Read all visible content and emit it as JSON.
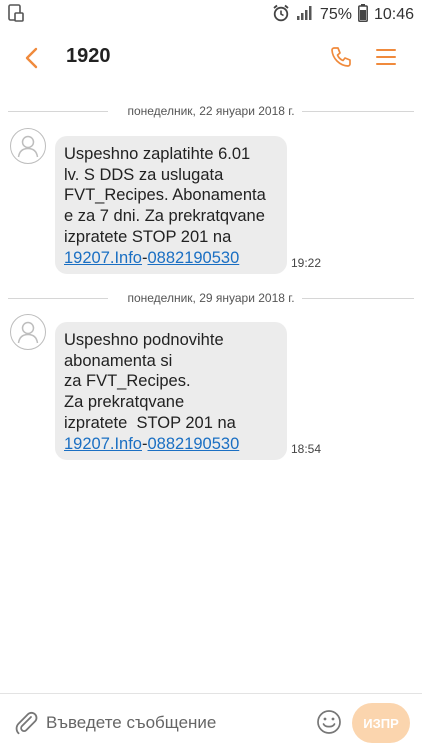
{
  "status_bar": {
    "battery_percent": "75%",
    "time": "10:46",
    "icons": [
      "screenshot-icon",
      "alarm-icon",
      "signal-icon",
      "battery-icon"
    ]
  },
  "app_bar": {
    "title": "1920",
    "accent_color": "#f08a3c",
    "icons": [
      "back-arrow-icon",
      "phone-icon",
      "menu-icon"
    ]
  },
  "conversation": {
    "messages": [
      {
        "date": "понеделник, 22 януари 2018 г.",
        "lines": [
          "Uspeshno zaplatihte 6.01",
          "lv. S DDS za uslugata",
          "FVT_Recipes. Abonamenta",
          "e za 7 dni. Za prekratqvane",
          "izpratete STOP 201 na"
        ],
        "link1": "19207.Info",
        "sep": "-",
        "link2": "0882190530",
        "time": "19:22"
      },
      {
        "date": "понеделник, 29 януари 2018 г.",
        "lines": [
          "Uspeshno podnovihte",
          "abonamenta si",
          "za FVT_Recipes.",
          "Za prekratqvane",
          "izpratete  STOP 201 na"
        ],
        "link1": "19207.Info",
        "sep": "-",
        "link2": "0882190530",
        "time": "18:54"
      }
    ]
  },
  "composer": {
    "placeholder": "Въведете съобщение",
    "send_label": "ИЗПР",
    "icons": [
      "attach-icon",
      "emoji-icon"
    ]
  }
}
